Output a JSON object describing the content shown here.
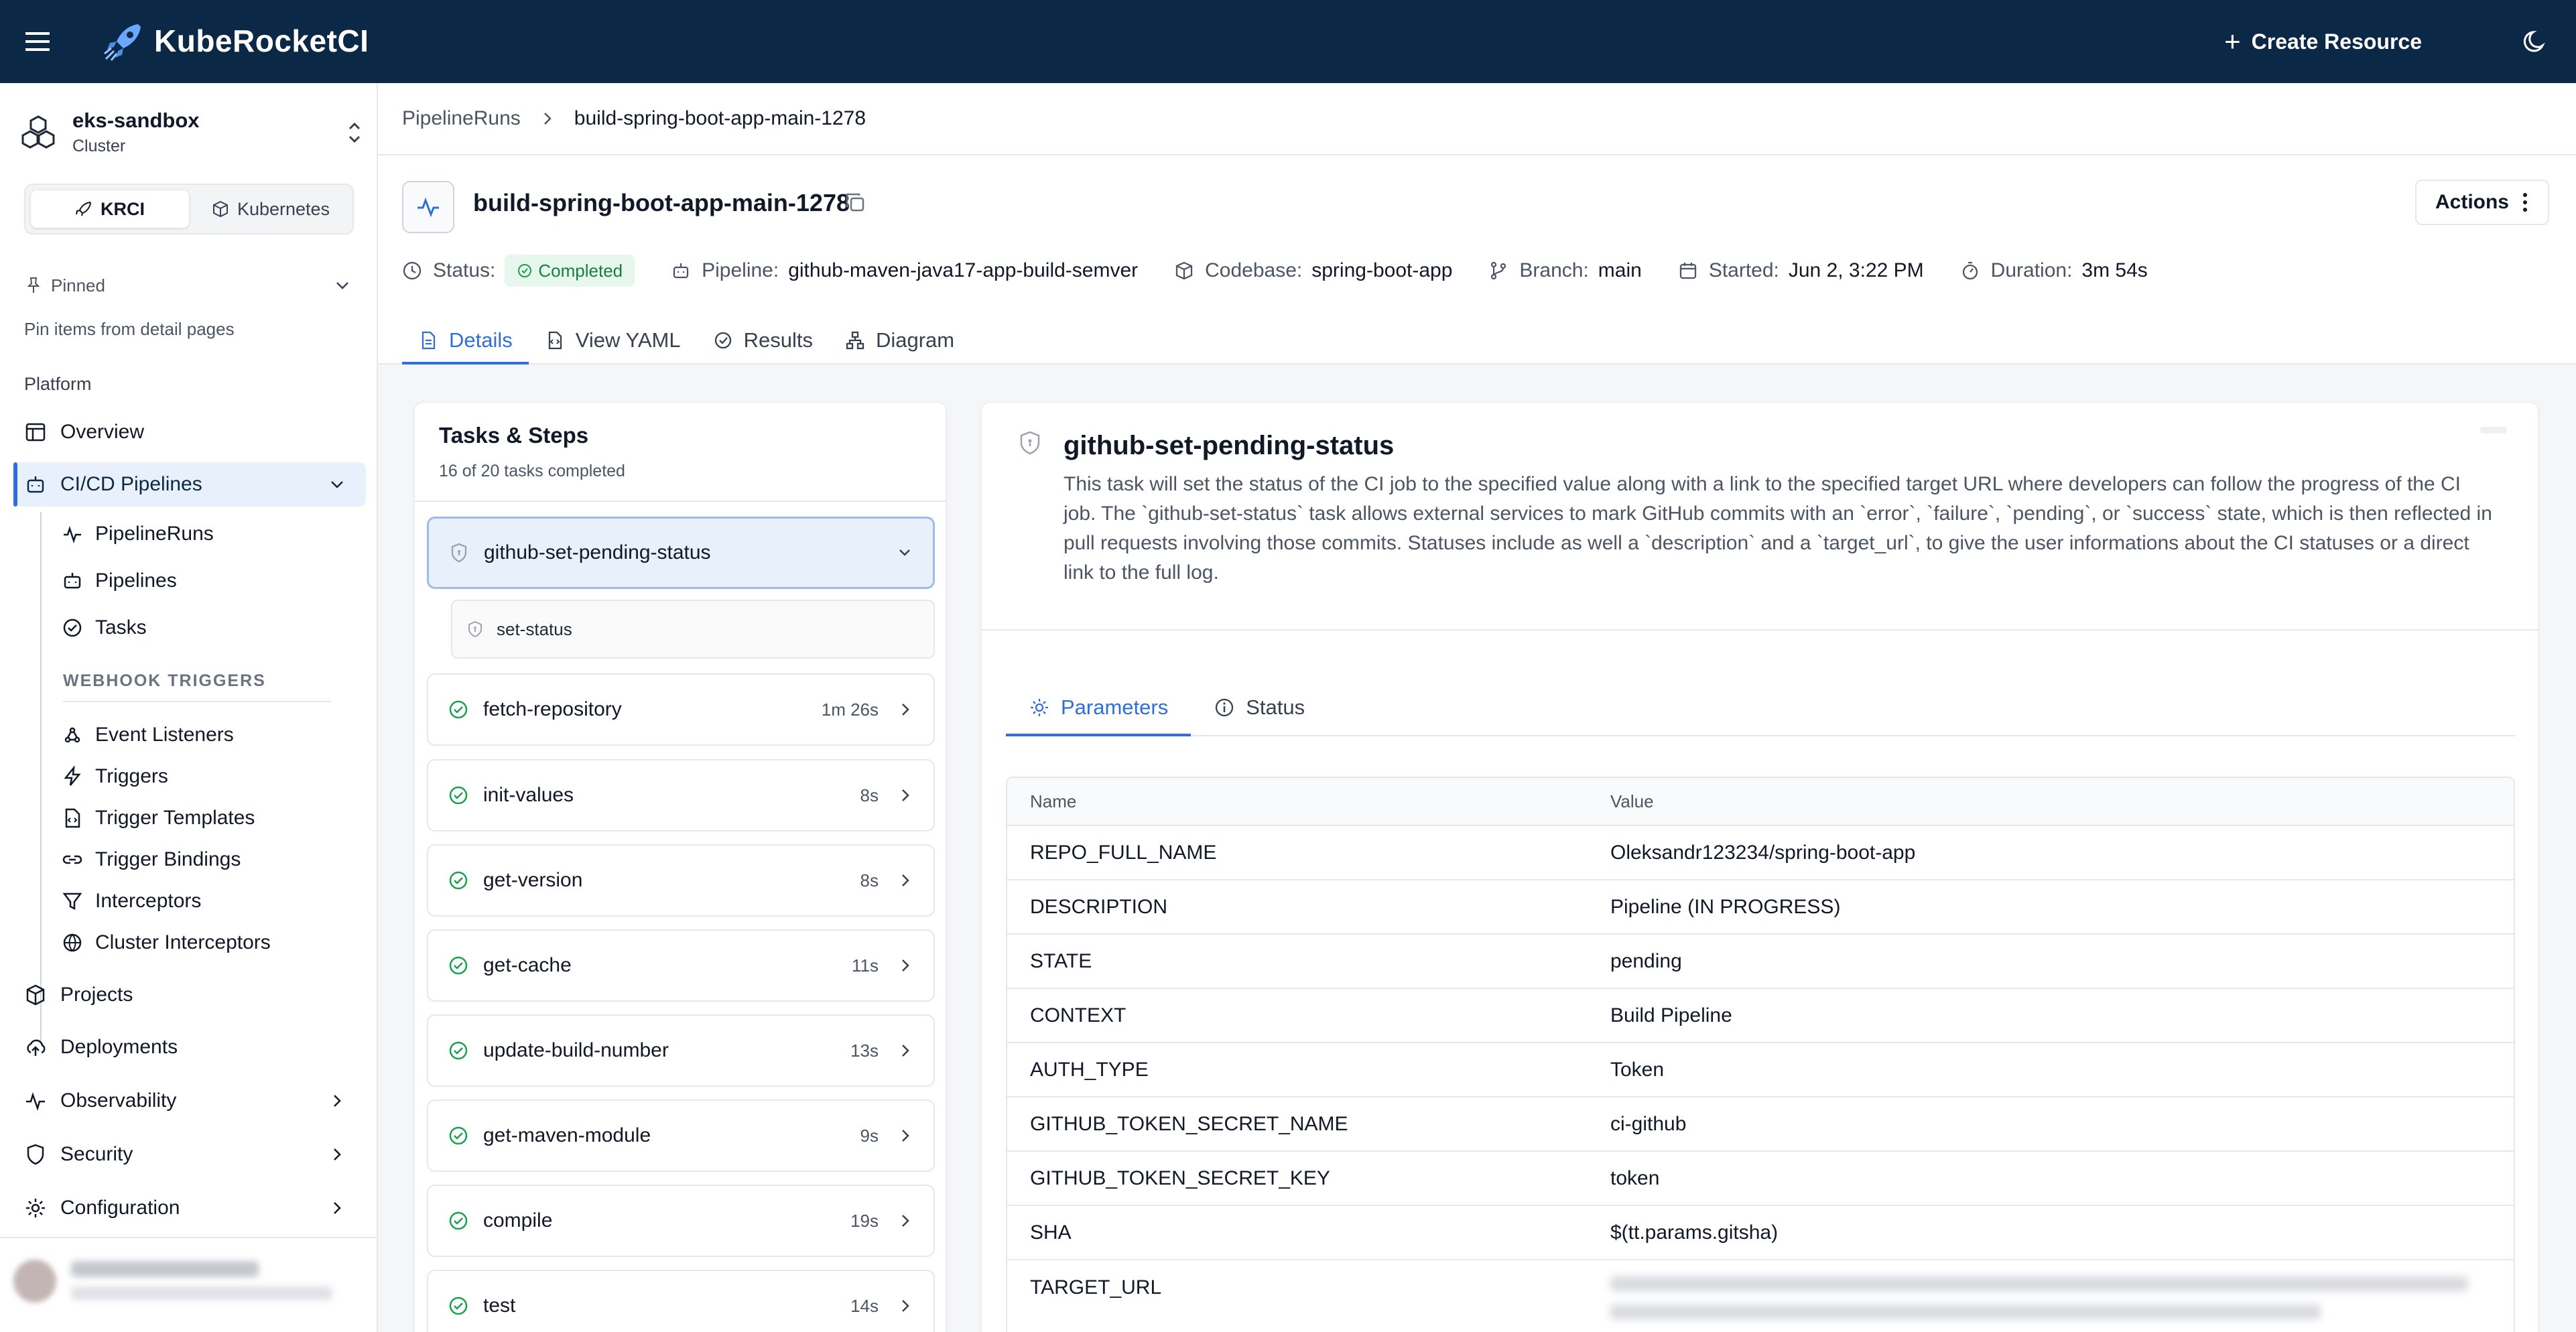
{
  "app": {
    "brand": "KubeRocketCI",
    "create_resource": "Create Resource"
  },
  "cluster": {
    "name": "eks-sandbox",
    "subtitle": "Cluster"
  },
  "switcher": {
    "krci": "KRCI",
    "kubernetes": "Kubernetes"
  },
  "sidebar": {
    "pinned_label": "Pinned",
    "pinned_hint": "Pin items from detail pages",
    "section_platform": "Platform",
    "overview": "Overview",
    "cicd": "CI/CD Pipelines",
    "sub": {
      "pipelineruns": "PipelineRuns",
      "pipelines": "Pipelines",
      "tasks": "Tasks"
    },
    "webhook_label": "WEBHOOK TRIGGERS",
    "webhook": {
      "event_listeners": "Event Listeners",
      "triggers": "Triggers",
      "trigger_templates": "Trigger Templates",
      "trigger_bindings": "Trigger Bindings",
      "interceptors": "Interceptors",
      "cluster_interceptors": "Cluster Interceptors"
    },
    "projects": "Projects",
    "deployments": "Deployments",
    "observability": "Observability",
    "security": "Security",
    "configuration": "Configuration"
  },
  "breadcrumb": {
    "parent": "PipelineRuns",
    "current": "build-spring-boot-app-main-1278"
  },
  "run": {
    "title": "build-spring-boot-app-main-1278",
    "actions": "Actions",
    "status_label": "Status:",
    "status_value": "Completed",
    "pipeline_label": "Pipeline:",
    "pipeline_value": "github-maven-java17-app-build-semver",
    "codebase_label": "Codebase:",
    "codebase_value": "spring-boot-app",
    "branch_label": "Branch:",
    "branch_value": "main",
    "started_label": "Started:",
    "started_value": "Jun 2, 3:22 PM",
    "duration_label": "Duration:",
    "duration_value": "3m 54s"
  },
  "tabs": {
    "details": "Details",
    "yaml": "View YAML",
    "results": "Results",
    "diagram": "Diagram"
  },
  "tasks": {
    "title": "Tasks & Steps",
    "subtitle": "16 of 20 tasks completed",
    "expanded_step": "set-status",
    "items": [
      {
        "name": "github-set-pending-status",
        "duration": ""
      },
      {
        "name": "fetch-repository",
        "duration": "1m 26s"
      },
      {
        "name": "init-values",
        "duration": "8s"
      },
      {
        "name": "get-version",
        "duration": "8s"
      },
      {
        "name": "get-cache",
        "duration": "11s"
      },
      {
        "name": "update-build-number",
        "duration": "13s"
      },
      {
        "name": "get-maven-module",
        "duration": "9s"
      },
      {
        "name": "compile",
        "duration": "19s"
      },
      {
        "name": "test",
        "duration": "14s"
      }
    ]
  },
  "detail": {
    "title": "github-set-pending-status",
    "description": "This task will set the status of the CI job to the specified value along with a link to the specified target URL where developers can follow the progress of the CI job. The `github-set-status` task allows external services to mark GitHub commits with an `error`, `failure`, `pending`, or `success` state, which is then reflected in pull requests involving those commits. Statuses include as well a `description` and a `target_url`, to give the user informations about the CI statuses or a direct link to the full log.",
    "tab_parameters": "Parameters",
    "tab_status": "Status",
    "col_name": "Name",
    "col_value": "Value",
    "params": [
      {
        "name": "REPO_FULL_NAME",
        "value": "Oleksandr123234/spring-boot-app"
      },
      {
        "name": "DESCRIPTION",
        "value": "Pipeline (IN PROGRESS)"
      },
      {
        "name": "STATE",
        "value": "pending"
      },
      {
        "name": "CONTEXT",
        "value": "Build Pipeline"
      },
      {
        "name": "AUTH_TYPE",
        "value": "Token"
      },
      {
        "name": "GITHUB_TOKEN_SECRET_NAME",
        "value": "ci-github"
      },
      {
        "name": "GITHUB_TOKEN_SECRET_KEY",
        "value": "token"
      },
      {
        "name": "SHA",
        "value": "$(tt.params.gitsha)"
      },
      {
        "name": "TARGET_URL",
        "value": ""
      }
    ]
  },
  "colors": {
    "topbar": "#0c2847",
    "accent": "#2f6fd6",
    "success": "#16a34a"
  },
  "icons": {
    "menu": "menu-icon",
    "logo": "rocket-icon",
    "theme": "moon-icon",
    "success": "check-circle-icon",
    "lock": "shield-icon"
  }
}
